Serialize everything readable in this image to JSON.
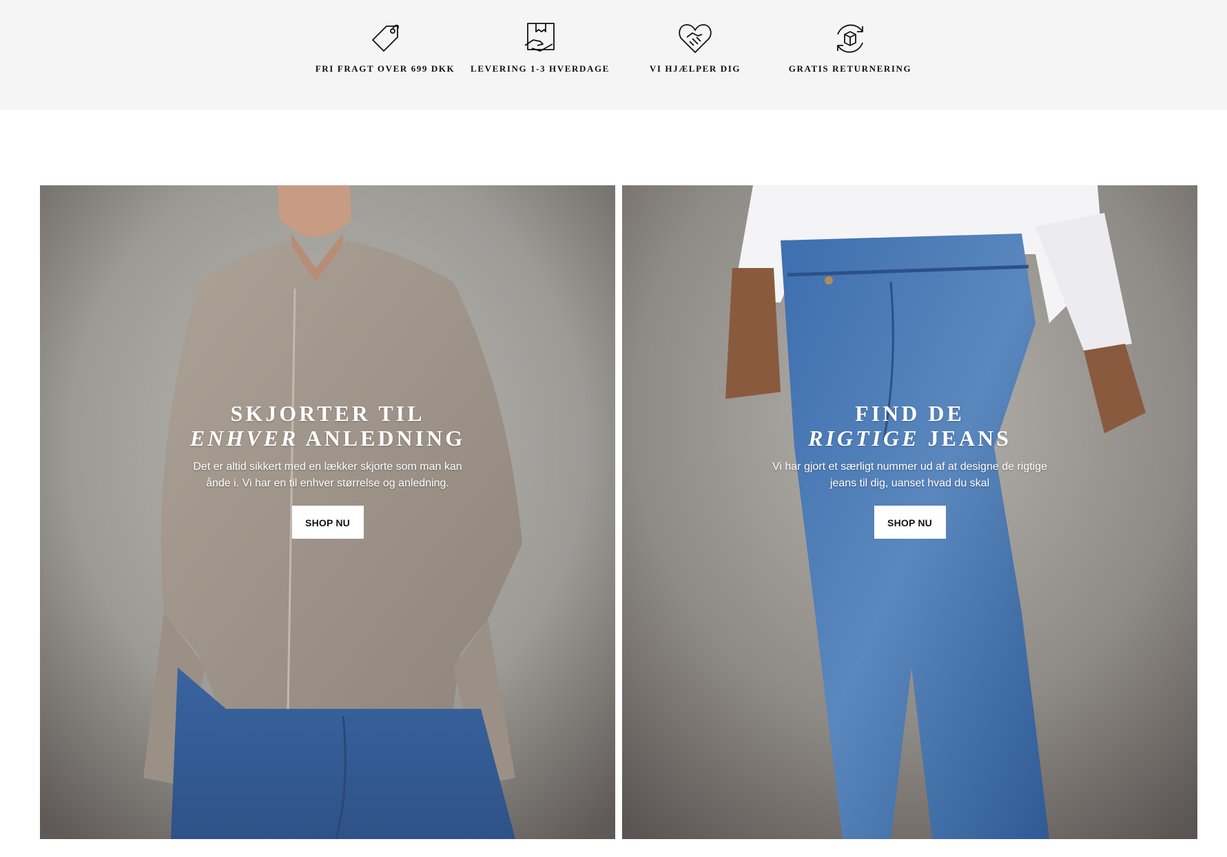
{
  "usp": [
    {
      "label": "FRI FRAGT OVER 699 DKK",
      "icon": "price-tag-icon"
    },
    {
      "label": "LEVERING 1-3 HVERDAGE",
      "icon": "package-delivery-icon"
    },
    {
      "label": "VI HJÆLPER DIG",
      "icon": "heart-handshake-icon"
    },
    {
      "label": "GRATIS RETURNERING",
      "icon": "return-box-icon"
    }
  ],
  "promos": [
    {
      "title_line1": "SKJORTER TIL",
      "title_em": "ENHVER",
      "title_rest": " ANLEDNING",
      "text": "Det er altid sikkert med en lækker skjorte som man kan ånde i. Vi har en til enhver størrelse og anledning.",
      "button": "SHOP NU"
    },
    {
      "title_line1": "FIND DE",
      "title_em": "RIGTIGE",
      "title_rest": " JEANS",
      "text": "Vi har gjort et særligt nummer ud af at designe de rigtige jeans til dig, uanset hvad du skal",
      "button": "SHOP NU"
    }
  ],
  "colors": {
    "usp_background": "#f5f5f5",
    "shirt": "#a0958b",
    "denim": "#3f6ea8"
  }
}
